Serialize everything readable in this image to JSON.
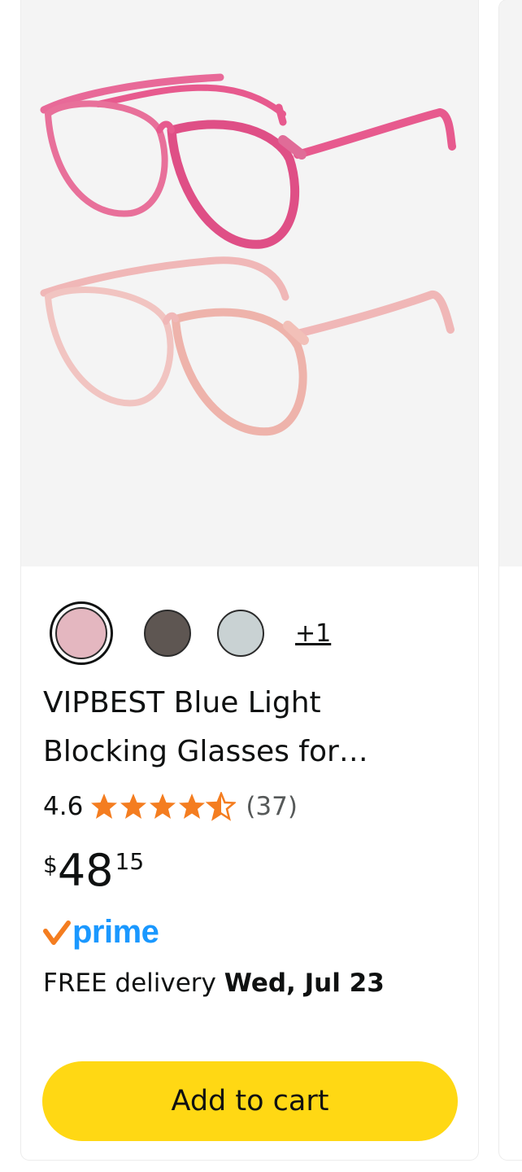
{
  "product": {
    "image_alt": "Two pairs of pink cat-eye eyeglasses",
    "title": "VIPBEST Blue Light Blocking Glasses for…",
    "rating_value": "4.6",
    "rating_stars": 4.5,
    "rating_count": "(37)",
    "price": {
      "symbol": "$",
      "whole": "48",
      "fraction": "15"
    },
    "prime_label": "prime",
    "delivery": {
      "prefix": "FREE delivery ",
      "date": "Wed, Jul 23"
    },
    "add_to_cart_label": "Add to cart",
    "swatches": [
      {
        "name": "pink",
        "color": "#e4b7c0",
        "selected": true
      },
      {
        "name": "dark-brown",
        "color": "#5e5652",
        "selected": false
      },
      {
        "name": "gray-blue",
        "color": "#c9d2d3",
        "selected": false
      }
    ],
    "more_colors_label": "+1"
  },
  "colors": {
    "star": "#f47d20",
    "prime_blue": "#1a98ff",
    "prime_check": "#f47d20",
    "button": "#ffd814",
    "image_bg": "#f4f4f4"
  }
}
